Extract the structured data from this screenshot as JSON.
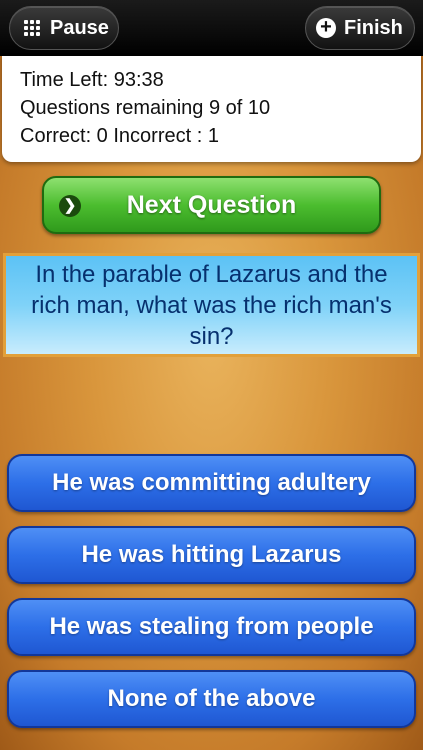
{
  "toolbar": {
    "pause_label": "Pause",
    "finish_label": "Finish"
  },
  "status": {
    "time_left": "Time Left: 93:38",
    "questions_remaining": "Questions remaining 9 of 10",
    "score": "Correct: 0 Incorrect : 1"
  },
  "next_button": {
    "label": "Next Question"
  },
  "question": {
    "text": "In the parable of Lazarus and the rich man, what was the rich man's sin?"
  },
  "answers": [
    {
      "label": "He was committing adultery"
    },
    {
      "label": "He was hitting Lazarus"
    },
    {
      "label": "He was stealing from people"
    },
    {
      "label": "None of the above"
    }
  ],
  "icons": {
    "pause": "grid-icon",
    "finish": "plus-icon",
    "next": "chevron-right-icon"
  },
  "colors": {
    "next_button": "#4cbd2f",
    "answer_button": "#2d6fe8",
    "question_text": "#06306e",
    "question_border": "#e2a03a"
  }
}
